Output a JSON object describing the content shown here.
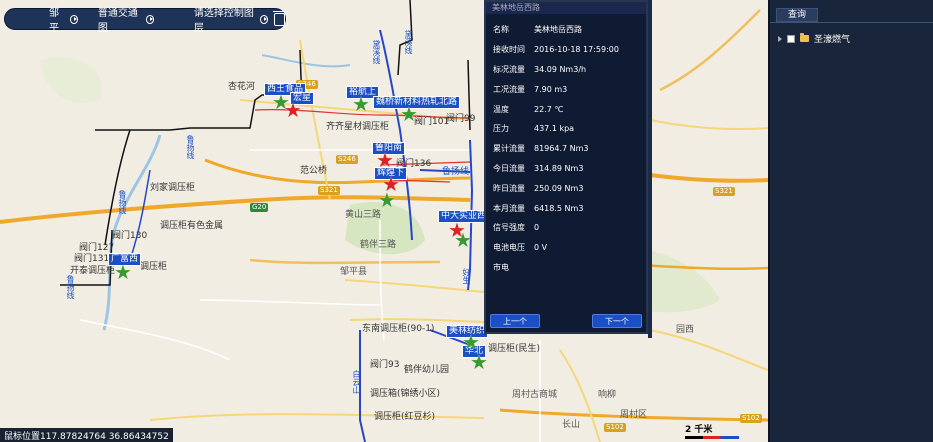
{
  "toolbar": {
    "district": "邹平",
    "traffic": "普通交通图",
    "layer": "请选择控制图层"
  },
  "info_panel": {
    "header": "美林地岳西路",
    "rows": [
      {
        "k": "名称",
        "v": "美林地岳西路"
      },
      {
        "k": "接收时间",
        "v": "2016-10-18 17:59:00"
      },
      {
        "k": "标况流量",
        "v": "34.09 Nm3/h"
      },
      {
        "k": "工况流量",
        "v": "7.90 m3"
      },
      {
        "k": "温度",
        "v": "22.7 ℃"
      },
      {
        "k": "压力",
        "v": "437.1 kpa"
      },
      {
        "k": "累计流量",
        "v": "81964.7 Nm3"
      },
      {
        "k": "今日流量",
        "v": "314.89 Nm3"
      },
      {
        "k": "昨日流量",
        "v": "250.09 Nm3"
      },
      {
        "k": "本月流量",
        "v": "6418.5 Nm3"
      },
      {
        "k": "信号强度",
        "v": "0"
      },
      {
        "k": "电池电压",
        "v": "0 V"
      },
      {
        "k": "市电",
        "v": ""
      }
    ],
    "prev_label": "上一个",
    "next_label": "下一个"
  },
  "right_panel": {
    "tab_label": "查询",
    "tree_item": "圣濠燃气"
  },
  "coords": "鼠标位置117.87824764 36.86434752",
  "scale_label": "2 千米",
  "map": {
    "blue_tags": {
      "xiwang": "西王食品",
      "hongxing": "宏星",
      "hangshang": "裕航上",
      "weiqiao": "魏桥新材料热轧北路",
      "luyang": "鲁阳南",
      "huixing": "辉煌下",
      "zhongda": "中大实业西",
      "guangfu": "广富西",
      "meilin": "美林纺织",
      "huabei": "华北"
    },
    "labels": {
      "xingnanhe": "杏花河",
      "s246": "S246",
      "qihou": "齐齐星材调压柜",
      "famen99": "阀门99",
      "famen101": "阀门101",
      "fangongxian": "黛溪线",
      "famen136": "阀门136",
      "fanggongxi": "范公桥",
      "s321": "S321",
      "luyangxian": "鲁扬线",
      "liujia": "刘家调压柜",
      "youse": "调压柜有色金属",
      "g20": "G20",
      "famen130": "阀门130",
      "famen127": "阀门127",
      "famen131": "阀门131",
      "kaitai": "开泰调压柜",
      "gaoxin": "调压柜",
      "zoupingxian": "邹平县",
      "dongnan": "东南调压柜(90-1)",
      "famen93": "阀门93",
      "heiwa": "鹤伴幼儿园",
      "jinxiu": "调压箱(锦绣小区)",
      "hongshan": "调压柜(红豆杉)",
      "minsheng": "调压柜(民生)",
      "zhoucun": "周村区",
      "s102": "S102",
      "haoshengxian": "好生",
      "baiyunxian": "白云山",
      "huangshan": "黄山三路",
      "heishan": "鹤伴三路",
      "yuanxi": "园西",
      "zhoucungu": "周村古商城",
      "xiangliu": "响柳",
      "changshan": "长山"
    }
  }
}
